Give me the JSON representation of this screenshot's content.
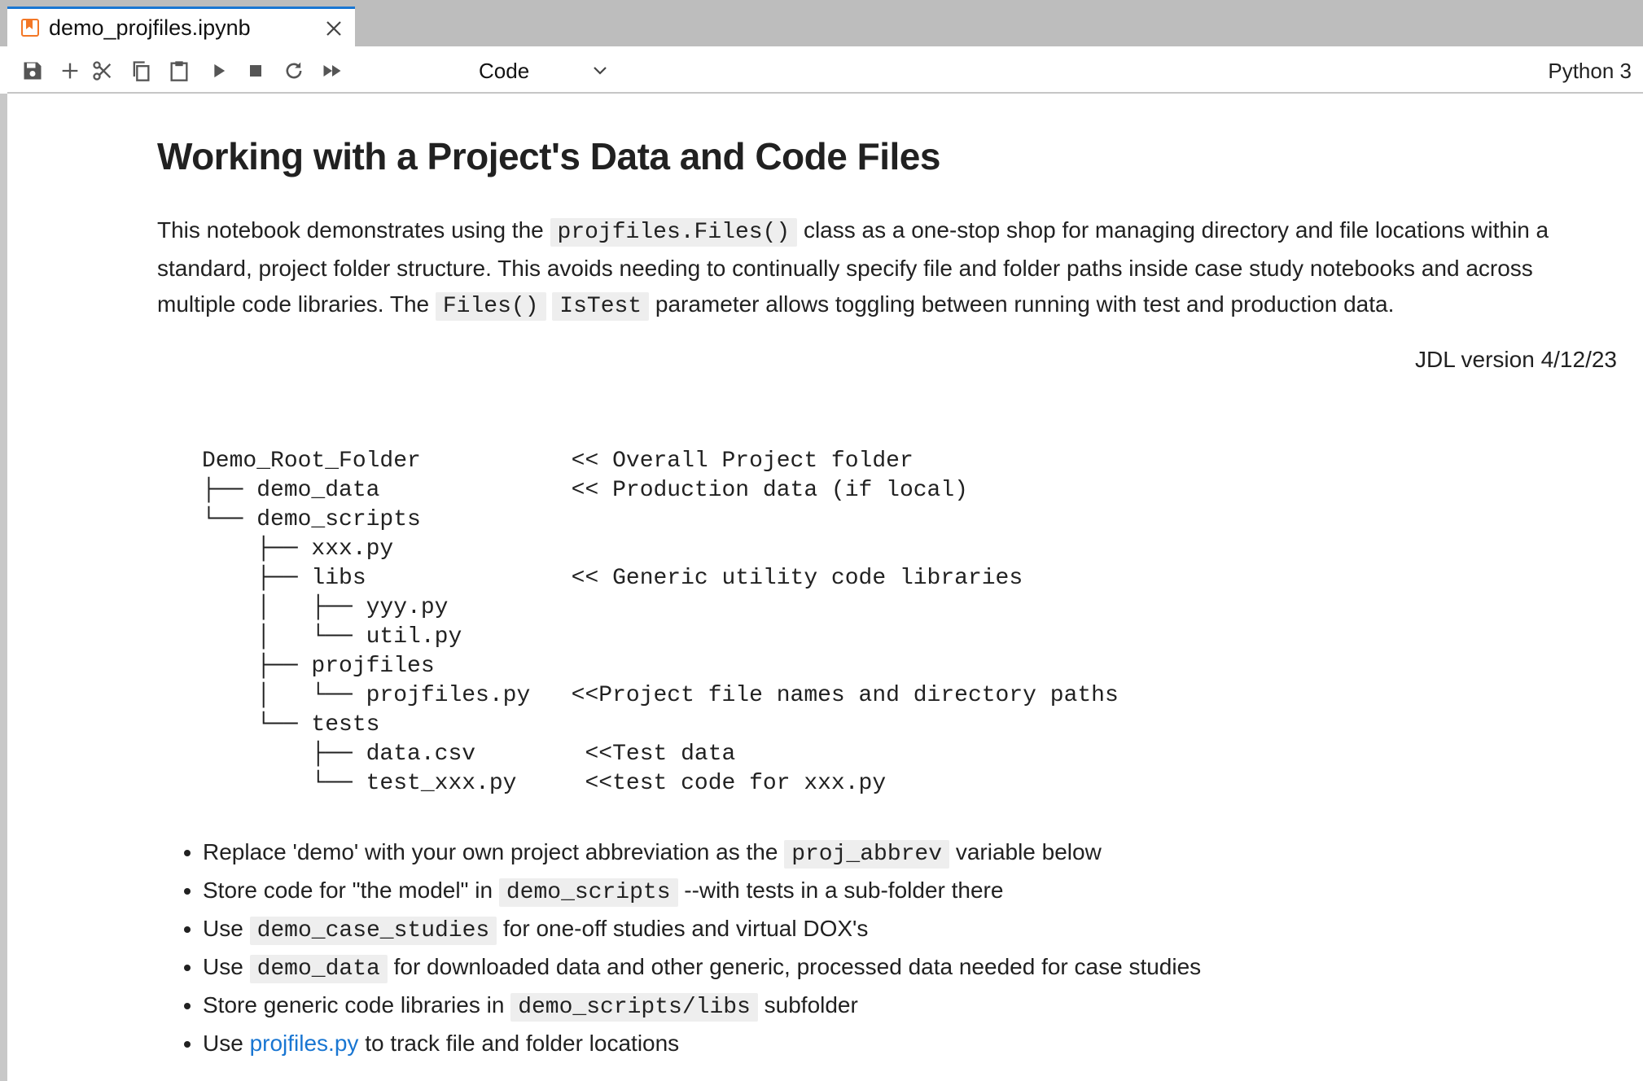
{
  "tab": {
    "title": "demo_projfiles.ipynb"
  },
  "toolbar": {
    "cell_type": "Code",
    "kernel": "Python 3",
    "icons": [
      "save-icon",
      "add-cell-icon",
      "cut-icon",
      "copy-icon",
      "paste-icon",
      "run-icon",
      "stop-icon",
      "restart-icon",
      "fast-forward-icon"
    ]
  },
  "markdown": {
    "title": "Working with a Project's Data and Code Files",
    "intro": {
      "t1": "This notebook demonstrates using the ",
      "c1": "projfiles.Files()",
      "t2": " class as a one-stop shop for managing directory and file locations within a standard, project folder structure. This avoids needing to continually specify file and folder paths inside case study notebooks and across multiple code libraries. The ",
      "c2": "Files()",
      "c3": "IsTest",
      "t3": " parameter allows toggling between running with test and production data."
    },
    "version": "JDL version 4/12/23",
    "tree_lines": [
      "Demo_Root_Folder           << Overall Project folder",
      "├── demo_data              << Production data (if local)",
      "└── demo_scripts",
      "    ├── xxx.py",
      "    ├── libs               << Generic utility code libraries",
      "    │   ├── yyy.py",
      "    │   └── util.py",
      "    ├── projfiles",
      "    │   └── projfiles.py   <<Project file names and directory paths",
      "    └── tests",
      "        ├── data.csv        <<Test data",
      "        └── test_xxx.py     <<test code for xxx.py"
    ],
    "bullets": {
      "b1": {
        "pre": "Replace 'demo' with your own project abbreviation as the ",
        "code": "proj_abbrev",
        "post": " variable below"
      },
      "b2": {
        "pre": "Store code for \"the model\" in ",
        "code": "demo_scripts",
        "post": " --with tests in a sub-folder there"
      },
      "b3": {
        "pre": "Use ",
        "code": "demo_case_studies",
        "post": " for one-off studies and virtual DOX's"
      },
      "b4": {
        "pre": "Use ",
        "code": "demo_data",
        "post": " for downloaded data and other generic, processed data needed for case studies"
      },
      "b5": {
        "pre": "Store generic code libraries in ",
        "code": "demo_scripts/libs",
        "post": " subfolder"
      },
      "b6": {
        "pre": "Use ",
        "link": "projfiles.py",
        "post": " to track file and folder locations"
      }
    }
  }
}
